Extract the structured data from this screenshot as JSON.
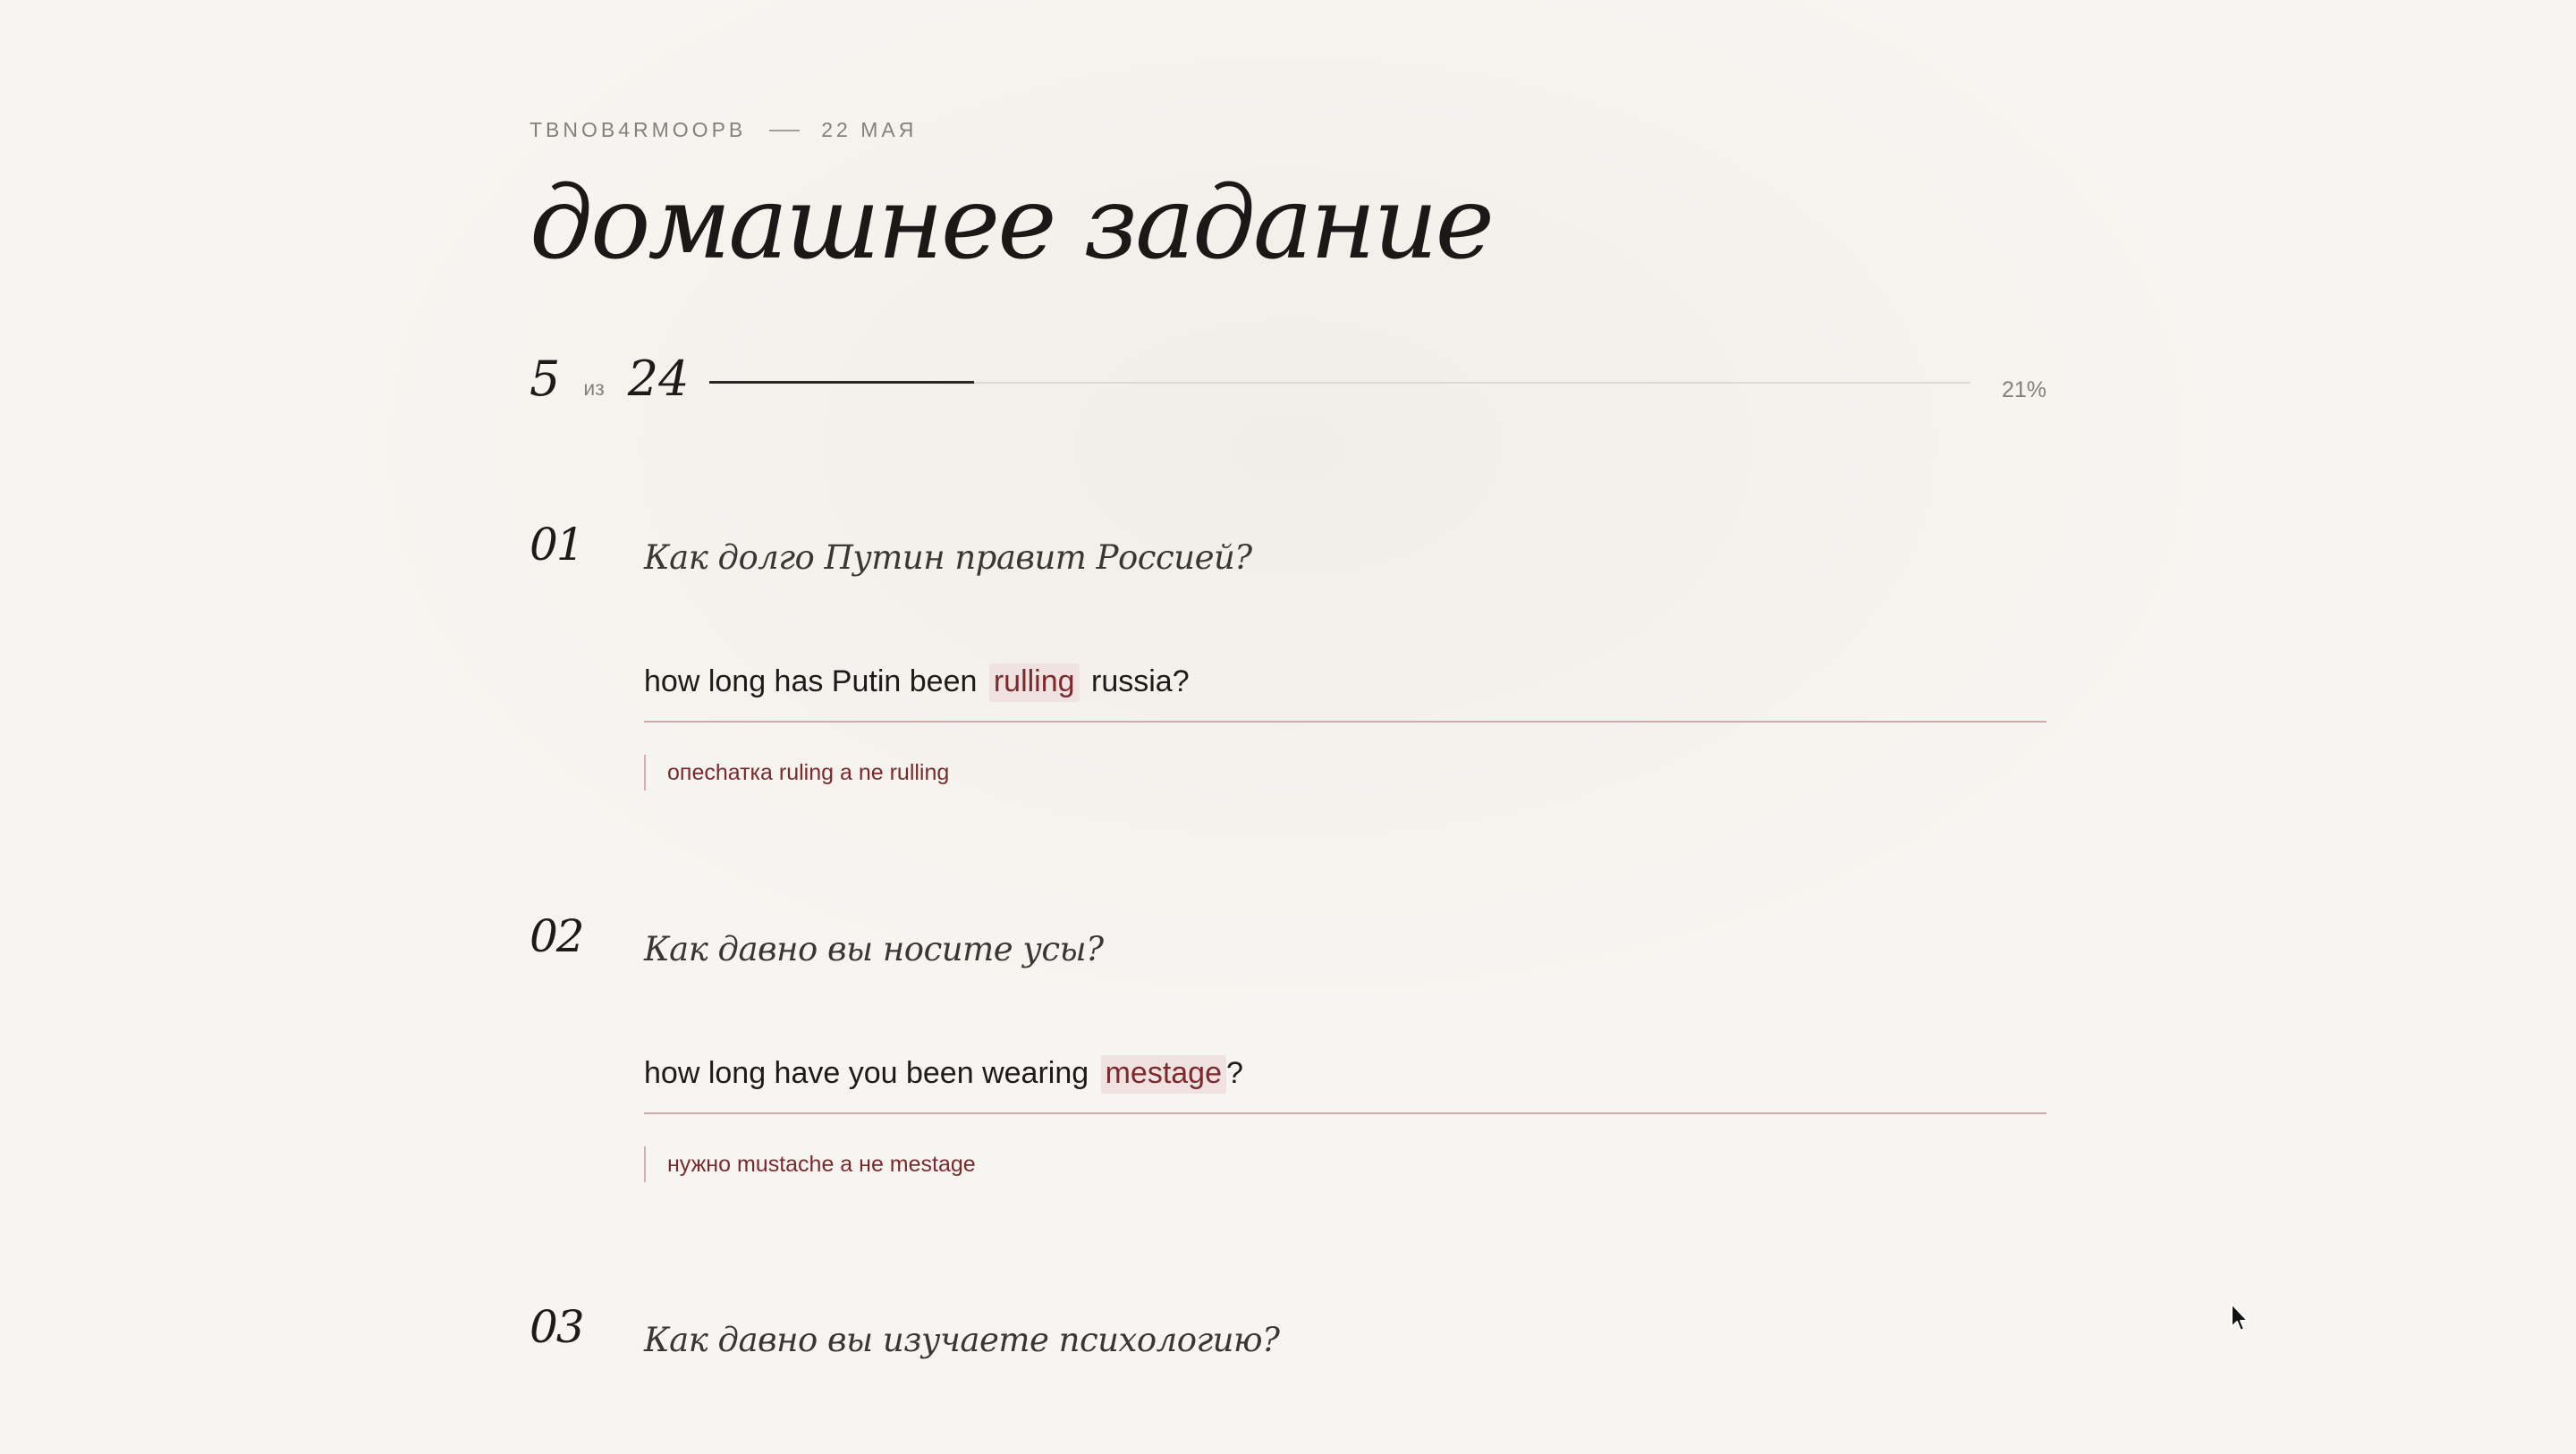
{
  "header": {
    "student": "TBNOB4RMOOPB",
    "date": "22 мая",
    "title": "домашнее задание"
  },
  "progress": {
    "current": "5",
    "of_label": "из",
    "total": "24",
    "percent_label": "21%",
    "fraction": 0.21
  },
  "questions": [
    {
      "number": "01",
      "prompt": "Как долго Путин правит Россией?",
      "answer_before": "how long has Putin been",
      "answer_error": "rulling",
      "answer_after": "russia?",
      "feedback": "опесhатка ruling a ne rulling"
    },
    {
      "number": "02",
      "prompt": "Как давно вы носите усы?",
      "answer_before": "how long have you been wearing",
      "answer_error": "mestage",
      "answer_after": "?",
      "feedback": "нужно mustache а не mestage"
    },
    {
      "number": "03",
      "prompt": "Как давно вы изучаете психологию?"
    }
  ],
  "colors": {
    "background": "#f7f5f1",
    "accent": "#7a2a2c",
    "error_highlight": "#f0e2e0",
    "underline": "#cfa9ab"
  },
  "icons": {
    "cursor": "mouse-pointer-icon"
  }
}
